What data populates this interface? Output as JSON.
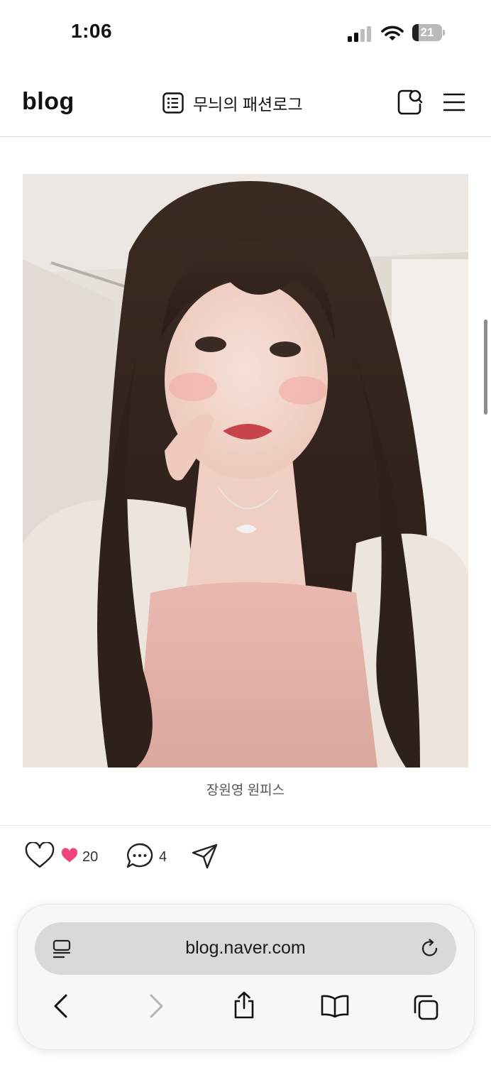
{
  "status_bar": {
    "time": "1:06",
    "battery": "21",
    "battery_level": 0.21
  },
  "header": {
    "logo": "blog",
    "title": "무늬의 패션로그"
  },
  "post": {
    "caption": "장원영 원피스"
  },
  "reactions": {
    "like_count": "20",
    "comment_count": "4",
    "heart_color": "#f0447a"
  },
  "browser": {
    "url": "blog.naver.com"
  },
  "colors": {
    "accent_heart": "#f0447a",
    "toolbar_bg": "#f7f7f7",
    "address_bg": "#d9d9d9",
    "text_primary": "#111111",
    "forward_disabled": "#b3b3b3"
  }
}
